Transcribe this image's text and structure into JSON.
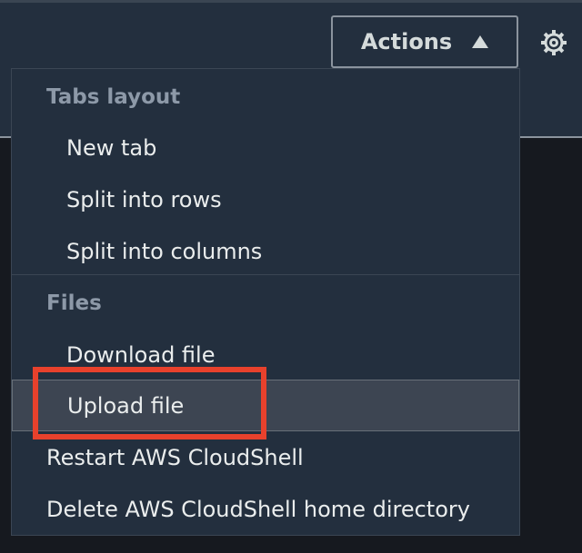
{
  "header": {
    "actions_label": "Actions",
    "caret_icon": "caret-up-icon",
    "settings_icon": "gear-icon"
  },
  "menu": {
    "sections": [
      {
        "title": "Tabs layout",
        "items": [
          "New tab",
          "Split into rows",
          "Split into columns"
        ]
      },
      {
        "title": "Files",
        "items": [
          "Download file",
          "Upload file"
        ]
      }
    ],
    "items": [
      "Restart AWS CloudShell",
      "Delete AWS CloudShell home directory"
    ],
    "selected_item": "Upload file"
  },
  "colors": {
    "highlight_annotation": "#e8412c",
    "menu_background": "#232f3e",
    "header_text": "#8d99a8",
    "item_text": "#eaeded"
  }
}
